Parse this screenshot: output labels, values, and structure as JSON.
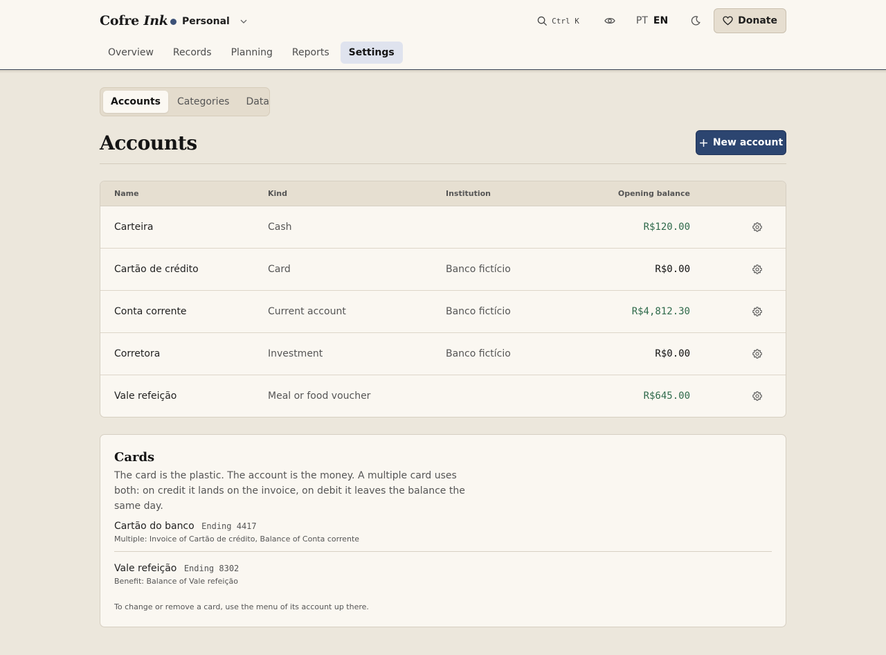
{
  "brand": {
    "name": "Cofre",
    "suffix": "Ink"
  },
  "workspace": {
    "label": "Personal",
    "dot_color": "#3d5278"
  },
  "search": {
    "shortcut": "Ctrl K"
  },
  "language": {
    "pt": "PT",
    "en": "EN",
    "active": "EN"
  },
  "donate": {
    "label": "Donate"
  },
  "nav": {
    "tabs": [
      {
        "label": "Overview"
      },
      {
        "label": "Records"
      },
      {
        "label": "Planning"
      },
      {
        "label": "Reports"
      },
      {
        "label": "Settings",
        "active": true
      }
    ]
  },
  "subtabs": [
    {
      "label": "Accounts",
      "active": true
    },
    {
      "label": "Categories"
    },
    {
      "label": "Data"
    }
  ],
  "page": {
    "title": "Accounts",
    "new_button": "New account"
  },
  "table": {
    "headers": {
      "name": "Name",
      "kind": "Kind",
      "institution": "Institution",
      "balance": "Opening balance"
    },
    "rows": [
      {
        "name": "Carteira",
        "kind": "Cash",
        "institution": "",
        "balance": "R$120.00",
        "positive": true
      },
      {
        "name": "Cartão de crédito",
        "kind": "Card",
        "institution": "Banco fictício",
        "balance": "R$0.00",
        "positive": false
      },
      {
        "name": "Conta corrente",
        "kind": "Current account",
        "institution": "Banco fictício",
        "balance": "R$4,812.30",
        "positive": true
      },
      {
        "name": "Corretora",
        "kind": "Investment",
        "institution": "Banco fictício",
        "balance": "R$0.00",
        "positive": false
      },
      {
        "name": "Vale refeição",
        "kind": "Meal or food voucher",
        "institution": "",
        "balance": "R$645.00",
        "positive": true
      }
    ]
  },
  "cards": {
    "title": "Cards",
    "description": "The card is the plastic. The account is the money. A multiple card uses both: on credit it lands on the invoice, on debit it leaves the balance the same day.",
    "items": [
      {
        "name": "Cartão do banco",
        "ending": "Ending 4417",
        "detail": "Multiple: Invoice of Cartão de crédito, Balance of Conta corrente"
      },
      {
        "name": "Vale refeição",
        "ending": "Ending 8302",
        "detail": "Benefit: Balance of Vale refeição"
      }
    ],
    "note": "To change or remove a card, use the menu of its account up there."
  },
  "colors": {
    "accent": "#2c4570",
    "positive_balance": "#2f6a4b",
    "background": "#ece7dc",
    "surface": "#faf7f1"
  },
  "icons": [
    "search-icon",
    "eye-icon",
    "moon-icon",
    "heart-icon",
    "plus-icon",
    "gear-icon",
    "chevron-down-icon"
  ]
}
